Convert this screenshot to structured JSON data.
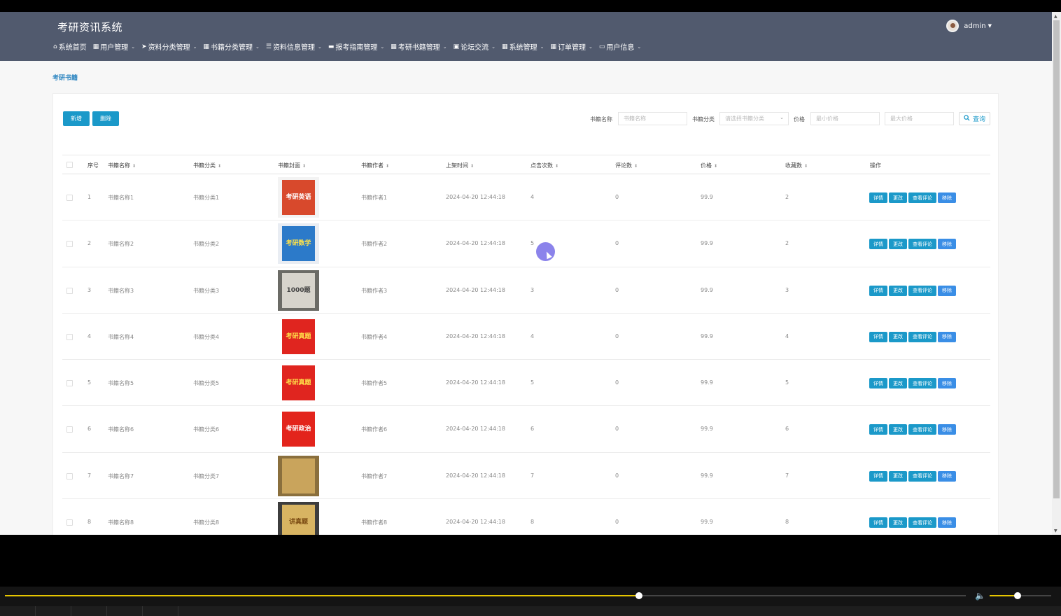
{
  "app": {
    "title": "考研资讯系统",
    "user": "admin"
  },
  "nav": [
    {
      "label": "系统首页",
      "icon": "home-icon",
      "glyph": "⌂",
      "dropdown": false
    },
    {
      "label": "用户管理",
      "icon": "grid-icon",
      "glyph": "▦",
      "dropdown": true
    },
    {
      "label": "资料分类管理",
      "icon": "send-icon",
      "glyph": "➤",
      "dropdown": true
    },
    {
      "label": "书籍分类管理",
      "icon": "grid-icon",
      "glyph": "▦",
      "dropdown": true
    },
    {
      "label": "资料信息管理",
      "icon": "list-icon",
      "glyph": "☰",
      "dropdown": true
    },
    {
      "label": "报考指南管理",
      "icon": "chat-icon",
      "glyph": "▬",
      "dropdown": true
    },
    {
      "label": "考研书籍管理",
      "icon": "grid-icon",
      "glyph": "▦",
      "dropdown": true
    },
    {
      "label": "论坛交流",
      "icon": "edit-icon",
      "glyph": "▣",
      "dropdown": true
    },
    {
      "label": "系统管理",
      "icon": "grid-icon",
      "glyph": "▦",
      "dropdown": true
    },
    {
      "label": "订单管理",
      "icon": "grid-icon",
      "glyph": "▦",
      "dropdown": true
    },
    {
      "label": "用户信息",
      "icon": "card-icon",
      "glyph": "▭",
      "dropdown": true
    }
  ],
  "breadcrumb": "考研书籍",
  "toolbar": {
    "add": "新增",
    "delete": "删除"
  },
  "search": {
    "name_label": "书籍名称",
    "name_placeholder": "书籍名称",
    "category_label": "书籍分类",
    "category_placeholder": "请选择书籍分类",
    "price_label": "价格",
    "min_placeholder": "最小价格",
    "max_placeholder": "最大价格",
    "query": "查询"
  },
  "columns": [
    "序号",
    "书籍名称",
    "书籍分类",
    "书籍封面",
    "书籍作者",
    "上架时间",
    "点击次数",
    "评论数",
    "价格",
    "收藏数",
    "操作"
  ],
  "actions": {
    "detail": "详情",
    "edit": "更改",
    "comments": "查看评论",
    "remove": "移除"
  },
  "rows": [
    {
      "no": "1",
      "name": "书籍名称1",
      "category": "书籍分类1",
      "author": "书籍作者1",
      "time": "2024-04-20 12:44:18",
      "clicks": "4",
      "comments": "0",
      "price": "99.9",
      "favorites": "2",
      "cover_text": "考研英语",
      "cover_bg": "#d8492c",
      "cover_fg": "#ffffff",
      "cover_frame": "#f3f3f3"
    },
    {
      "no": "2",
      "name": "书籍名称2",
      "category": "书籍分类2",
      "author": "书籍作者2",
      "time": "2024-04-20 12:44:18",
      "clicks": "5",
      "comments": "0",
      "price": "99.9",
      "favorites": "2",
      "cover_text": "考研数学",
      "cover_bg": "#2c7ac9",
      "cover_fg": "#ffe24a",
      "cover_frame": "#e9edf3"
    },
    {
      "no": "3",
      "name": "书籍名称3",
      "category": "书籍分类3",
      "author": "书籍作者3",
      "time": "2024-04-20 12:44:18",
      "clicks": "3",
      "comments": "0",
      "price": "99.9",
      "favorites": "3",
      "cover_text": "1000题",
      "cover_bg": "#d7d4cc",
      "cover_fg": "#444444",
      "cover_frame": "#6b6b66"
    },
    {
      "no": "4",
      "name": "书籍名称4",
      "category": "书籍分类4",
      "author": "书籍作者4",
      "time": "2024-04-20 12:44:18",
      "clicks": "4",
      "comments": "0",
      "price": "99.9",
      "favorites": "4",
      "cover_text": "考研真题",
      "cover_bg": "#e0251f",
      "cover_fg": "#ffe04a",
      "cover_frame": "#ffffff"
    },
    {
      "no": "5",
      "name": "书籍名称5",
      "category": "书籍分类5",
      "author": "书籍作者5",
      "time": "2024-04-20 12:44:18",
      "clicks": "5",
      "comments": "0",
      "price": "99.9",
      "favorites": "5",
      "cover_text": "考研真题",
      "cover_bg": "#e0251f",
      "cover_fg": "#ffe04a",
      "cover_frame": "#ffffff"
    },
    {
      "no": "6",
      "name": "书籍名称6",
      "category": "书籍分类6",
      "author": "书籍作者6",
      "time": "2024-04-20 12:44:18",
      "clicks": "6",
      "comments": "0",
      "price": "99.9",
      "favorites": "6",
      "cover_text": "考研政治",
      "cover_bg": "#e3241c",
      "cover_fg": "#ffffff",
      "cover_frame": "#ffffff"
    },
    {
      "no": "7",
      "name": "书籍名称7",
      "category": "书籍分类7",
      "author": "书籍作者7",
      "time": "2024-04-20 12:44:18",
      "clicks": "7",
      "comments": "0",
      "price": "99.9",
      "favorites": "7",
      "cover_text": "",
      "cover_bg": "#c9a45c",
      "cover_fg": "#ffffff",
      "cover_frame": "#8a6f3d"
    },
    {
      "no": "8",
      "name": "书籍名称8",
      "category": "书籍分类8",
      "author": "书籍作者8",
      "time": "2024-04-20 12:44:18",
      "clicks": "8",
      "comments": "0",
      "price": "99.9",
      "favorites": "8",
      "cover_text": "讲真题",
      "cover_bg": "#d8b462",
      "cover_fg": "#7a4a12",
      "cover_frame": "#3d3d3d"
    }
  ],
  "player": {
    "progress": 0.66,
    "volume": 0.45
  },
  "colors": {
    "header": "#515a6e",
    "primary": "#1b99c9",
    "remove": "#3a8ee6",
    "accent": "#e6c600"
  }
}
